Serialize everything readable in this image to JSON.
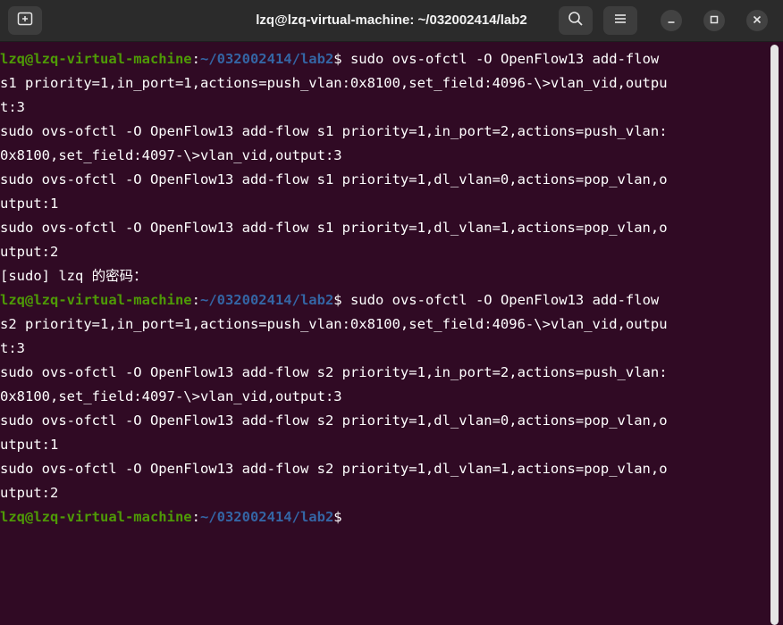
{
  "window": {
    "title": "lzq@lzq-virtual-machine: ~/032002414/lab2"
  },
  "icons": {
    "new_tab": "new-tab-icon",
    "search": "search-icon",
    "menu": "hamburger-menu-icon",
    "minimize": "minimize-icon",
    "maximize": "maximize-icon",
    "close": "close-icon"
  },
  "colors": {
    "terminal_bg": "#300a24",
    "prompt_user": "#4e9a06",
    "prompt_path": "#3465a4",
    "text": "#ffffff",
    "titlebar_bg": "#2b2b2b"
  },
  "terminal": {
    "prompt_user": "lzq@lzq-virtual-machine",
    "prompt_colon": ":",
    "prompt_path": "~/032002414/lab2",
    "prompt_dollar": "$",
    "lines": [
      {
        "prompt": true,
        "text": " sudo ovs-ofctl -O OpenFlow13 add-flow"
      },
      {
        "prompt": false,
        "text": "s1 priority=1,in_port=1,actions=push_vlan:0x8100,set_field:4096-\\>vlan_vid,outpu"
      },
      {
        "prompt": false,
        "text": "t:3"
      },
      {
        "prompt": false,
        "text": "sudo ovs-ofctl -O OpenFlow13 add-flow s1 priority=1,in_port=2,actions=push_vlan:"
      },
      {
        "prompt": false,
        "text": "0x8100,set_field:4097-\\>vlan_vid,output:3"
      },
      {
        "prompt": false,
        "text": "sudo ovs-ofctl -O OpenFlow13 add-flow s1 priority=1,dl_vlan=0,actions=pop_vlan,o"
      },
      {
        "prompt": false,
        "text": "utput:1"
      },
      {
        "prompt": false,
        "text": "sudo ovs-ofctl -O OpenFlow13 add-flow s1 priority=1,dl_vlan=1,actions=pop_vlan,o"
      },
      {
        "prompt": false,
        "text": "utput:2"
      },
      {
        "prompt": false,
        "text": "[sudo] lzq 的密码："
      },
      {
        "prompt": true,
        "text": " sudo ovs-ofctl -O OpenFlow13 add-flow"
      },
      {
        "prompt": false,
        "text": "s2 priority=1,in_port=1,actions=push_vlan:0x8100,set_field:4096-\\>vlan_vid,outpu"
      },
      {
        "prompt": false,
        "text": "t:3"
      },
      {
        "prompt": false,
        "text": "sudo ovs-ofctl -O OpenFlow13 add-flow s2 priority=1,in_port=2,actions=push_vlan:"
      },
      {
        "prompt": false,
        "text": "0x8100,set_field:4097-\\>vlan_vid,output:3"
      },
      {
        "prompt": false,
        "text": "sudo ovs-ofctl -O OpenFlow13 add-flow s2 priority=1,dl_vlan=0,actions=pop_vlan,o"
      },
      {
        "prompt": false,
        "text": "utput:1"
      },
      {
        "prompt": false,
        "text": "sudo ovs-ofctl -O OpenFlow13 add-flow s2 priority=1,dl_vlan=1,actions=pop_vlan,o"
      },
      {
        "prompt": false,
        "text": "utput:2"
      },
      {
        "prompt": true,
        "text": ""
      }
    ]
  }
}
